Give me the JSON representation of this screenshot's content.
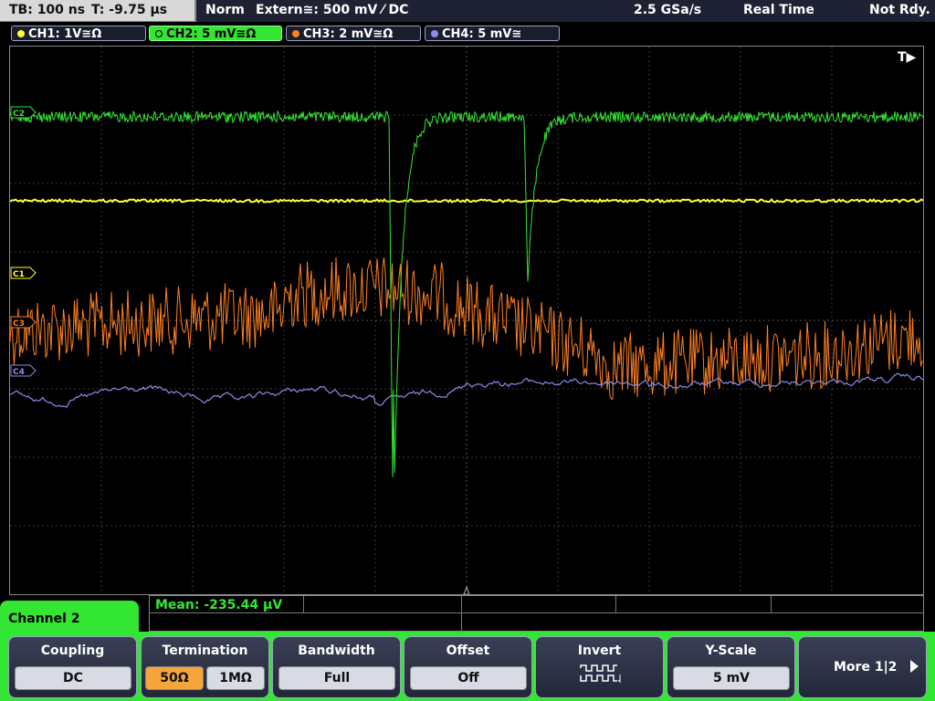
{
  "status_bar": {
    "timebase": "TB: 100 ns",
    "trigger_time": "T: -9.75 µs",
    "trigger_mode": "Norm",
    "trigger_source": "Extern≅: 500 mV ⁄ DC",
    "sample_rate": "2.5 GSa/s",
    "acq_mode": "Real Time",
    "acq_state": "Not Rdy."
  },
  "channels": [
    {
      "label": "CH1: 1V≅Ω",
      "color": "#ffff33",
      "marker": "C1"
    },
    {
      "label": "CH2: 5 mV≅Ω",
      "color": "#33e633",
      "marker": "C2"
    },
    {
      "label": "CH3: 2 mV≅Ω",
      "color": "#ff8020",
      "marker": "C3"
    },
    {
      "label": "CH4: 5 mV≅",
      "color": "#8a8ce8",
      "marker": "C4"
    }
  ],
  "trigger_marker": "T▶",
  "bottom": {
    "menu_title": "Channel 2",
    "measurement": "Mean: -235.44 µV"
  },
  "softkeys": {
    "coupling": {
      "title": "Coupling",
      "value": "DC"
    },
    "termination": {
      "title": "Termination",
      "opt1": "50Ω",
      "opt2": "1MΩ"
    },
    "bandwidth": {
      "title": "Bandwidth",
      "value": "Full"
    },
    "offset": {
      "title": "Offset",
      "value": "Off"
    },
    "invert": {
      "title": "Invert"
    },
    "yscale": {
      "title": "Y-Scale",
      "value": "5 mV"
    },
    "more": {
      "label": "More 1|2"
    }
  }
}
